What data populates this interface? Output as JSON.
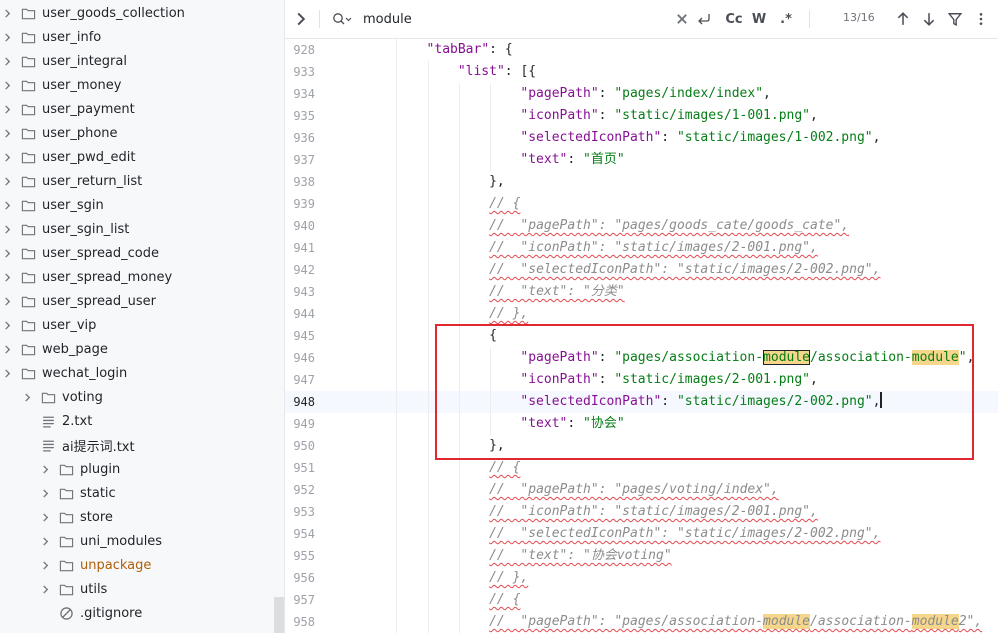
{
  "sidebar": {
    "items": [
      {
        "label": "user_goods_collection",
        "kind": "folder",
        "expandable": true,
        "depth": 2
      },
      {
        "label": "user_info",
        "kind": "folder",
        "expandable": true,
        "depth": 2
      },
      {
        "label": "user_integral",
        "kind": "folder",
        "expandable": true,
        "depth": 2
      },
      {
        "label": "user_money",
        "kind": "folder",
        "expandable": true,
        "depth": 2
      },
      {
        "label": "user_payment",
        "kind": "folder",
        "expandable": true,
        "depth": 2
      },
      {
        "label": "user_phone",
        "kind": "folder",
        "expandable": true,
        "depth": 2
      },
      {
        "label": "user_pwd_edit",
        "kind": "folder",
        "expandable": true,
        "depth": 2
      },
      {
        "label": "user_return_list",
        "kind": "folder",
        "expandable": true,
        "depth": 2
      },
      {
        "label": "user_sgin",
        "kind": "folder",
        "expandable": true,
        "depth": 2
      },
      {
        "label": "user_sgin_list",
        "kind": "folder",
        "expandable": true,
        "depth": 2
      },
      {
        "label": "user_spread_code",
        "kind": "folder",
        "expandable": true,
        "depth": 2
      },
      {
        "label": "user_spread_money",
        "kind": "folder",
        "expandable": true,
        "depth": 2
      },
      {
        "label": "user_spread_user",
        "kind": "folder",
        "expandable": true,
        "depth": 2
      },
      {
        "label": "user_vip",
        "kind": "folder",
        "expandable": true,
        "depth": 2
      },
      {
        "label": "web_page",
        "kind": "folder",
        "expandable": true,
        "depth": 2
      },
      {
        "label": "wechat_login",
        "kind": "folder",
        "expandable": true,
        "depth": 2
      },
      {
        "label": "voting",
        "kind": "folder",
        "expandable": true,
        "depth": 1
      },
      {
        "label": "2.txt",
        "kind": "text-file",
        "expandable": false,
        "depth": 1
      },
      {
        "label": "ai提示词.txt",
        "kind": "text-file",
        "expandable": false,
        "depth": 1
      },
      {
        "label": "plugin",
        "kind": "folder",
        "expandable": true,
        "depth": 0
      },
      {
        "label": "static",
        "kind": "folder",
        "expandable": true,
        "depth": 0
      },
      {
        "label": "store",
        "kind": "folder",
        "expandable": true,
        "depth": 0
      },
      {
        "label": "uni_modules",
        "kind": "folder",
        "expandable": true,
        "depth": 0
      },
      {
        "label": "unpackage",
        "kind": "folder",
        "expandable": true,
        "depth": 0,
        "highlight": "orange"
      },
      {
        "label": "utils",
        "kind": "folder",
        "expandable": true,
        "depth": 0
      },
      {
        "label": ".gitignore",
        "kind": "ignore-file",
        "expandable": false,
        "depth": 0
      }
    ]
  },
  "search": {
    "value": "module",
    "match_count": "13/16",
    "toggle_case": "Cc",
    "toggle_word": "W",
    "toggle_regex": ".*"
  },
  "colors": {
    "key": "#871094",
    "string": "#067d17",
    "comment": "#8c8c8c",
    "match_highlight": "#f6d68a",
    "annotation_box": "#e0282e",
    "folder_orange": "#b05f0a"
  },
  "editor": {
    "current_line": "948",
    "lines": [
      {
        "n": "928",
        "indent": 2,
        "tokens": [
          [
            "key",
            "\"tabBar\""
          ],
          [
            "p",
            ": {"
          ]
        ]
      },
      {
        "n": "933",
        "indent": 3,
        "tokens": [
          [
            "key",
            "\"list\""
          ],
          [
            "p",
            ": [{"
          ]
        ]
      },
      {
        "n": "934",
        "indent": 5,
        "tokens": [
          [
            "key",
            "\"pagePath\""
          ],
          [
            "p",
            ": "
          ],
          [
            "str",
            "\"pages/index/index\""
          ],
          [
            "p",
            ","
          ]
        ]
      },
      {
        "n": "935",
        "indent": 5,
        "tokens": [
          [
            "key",
            "\"iconPath\""
          ],
          [
            "p",
            ": "
          ],
          [
            "str",
            "\"static/images/1-001.png\""
          ],
          [
            "p",
            ","
          ]
        ]
      },
      {
        "n": "936",
        "indent": 5,
        "tokens": [
          [
            "key",
            "\"selectedIconPath\""
          ],
          [
            "p",
            ": "
          ],
          [
            "str",
            "\"static/images/1-002.png\""
          ],
          [
            "p",
            ","
          ]
        ]
      },
      {
        "n": "937",
        "indent": 5,
        "tokens": [
          [
            "key",
            "\"text\""
          ],
          [
            "p",
            ": "
          ],
          [
            "str",
            "\"首页\""
          ]
        ]
      },
      {
        "n": "938",
        "indent": 4,
        "tokens": [
          [
            "p",
            "},"
          ]
        ]
      },
      {
        "n": "939",
        "indent": 4,
        "tokens": [
          [
            "cmt",
            "// {"
          ]
        ]
      },
      {
        "n": "940",
        "indent": 4,
        "tokens": [
          [
            "cmt",
            "//  \"pagePath\": \"pages/goods_cate/goods_cate\","
          ]
        ]
      },
      {
        "n": "941",
        "indent": 4,
        "tokens": [
          [
            "cmt",
            "//  \"iconPath\": \"static/images/2-001.png\","
          ]
        ]
      },
      {
        "n": "942",
        "indent": 4,
        "tokens": [
          [
            "cmt",
            "//  \"selectedIconPath\": \"static/images/2-002.png\","
          ]
        ]
      },
      {
        "n": "943",
        "indent": 4,
        "tokens": [
          [
            "cmt",
            "//  \"text\": \"分类\""
          ]
        ]
      },
      {
        "n": "944",
        "indent": 4,
        "tokens": [
          [
            "cmt",
            "// },"
          ]
        ]
      },
      {
        "n": "945",
        "indent": 4,
        "tokens": [
          [
            "p",
            "{"
          ]
        ]
      },
      {
        "n": "946",
        "indent": 5,
        "tokens": [
          [
            "key",
            "\"pagePath\""
          ],
          [
            "p",
            ": "
          ],
          [
            "str",
            "\"pages/association-"
          ],
          [
            "hlcur",
            "module"
          ],
          [
            "str",
            "/association-"
          ],
          [
            "hl",
            "module"
          ],
          [
            "str",
            "\""
          ],
          [
            "p",
            ","
          ]
        ]
      },
      {
        "n": "947",
        "indent": 5,
        "tokens": [
          [
            "key",
            "\"iconPath\""
          ],
          [
            "p",
            ": "
          ],
          [
            "str",
            "\"static/images/2-001.png\""
          ],
          [
            "p",
            ","
          ]
        ]
      },
      {
        "n": "948",
        "indent": 5,
        "tokens": [
          [
            "key",
            "\"selectedIconPath\""
          ],
          [
            "p",
            ": "
          ],
          [
            "str",
            "\"static/images/2-002.png\""
          ],
          [
            "p",
            ","
          ],
          [
            "caret",
            ""
          ]
        ]
      },
      {
        "n": "949",
        "indent": 5,
        "tokens": [
          [
            "key",
            "\"text\""
          ],
          [
            "p",
            ": "
          ],
          [
            "str",
            "\"协会\""
          ]
        ]
      },
      {
        "n": "950",
        "indent": 4,
        "tokens": [
          [
            "p",
            "},"
          ]
        ]
      },
      {
        "n": "951",
        "indent": 4,
        "tokens": [
          [
            "cmt",
            "// {"
          ]
        ]
      },
      {
        "n": "952",
        "indent": 4,
        "tokens": [
          [
            "cmt",
            "//  \"pagePath\": \"pages/voting/index\","
          ]
        ]
      },
      {
        "n": "953",
        "indent": 4,
        "tokens": [
          [
            "cmt",
            "//  \"iconPath\": \"static/images/2-001.png\","
          ]
        ]
      },
      {
        "n": "954",
        "indent": 4,
        "tokens": [
          [
            "cmt",
            "//  \"selectedIconPath\": \"static/images/2-002.png\","
          ]
        ]
      },
      {
        "n": "955",
        "indent": 4,
        "tokens": [
          [
            "cmt",
            "//  \"text\": \"协会voting\""
          ]
        ]
      },
      {
        "n": "956",
        "indent": 4,
        "tokens": [
          [
            "cmt",
            "// },"
          ]
        ]
      },
      {
        "n": "957",
        "indent": 4,
        "tokens": [
          [
            "cmt",
            "// {"
          ]
        ]
      },
      {
        "n": "958",
        "indent": 4,
        "tokens": [
          [
            "cmt",
            "//  \"pagePath\": \"pages/association-"
          ],
          [
            "cmthl",
            "module"
          ],
          [
            "cmt",
            "/association-"
          ],
          [
            "cmthl",
            "module"
          ],
          [
            "cmt",
            "2\","
          ]
        ]
      }
    ]
  }
}
